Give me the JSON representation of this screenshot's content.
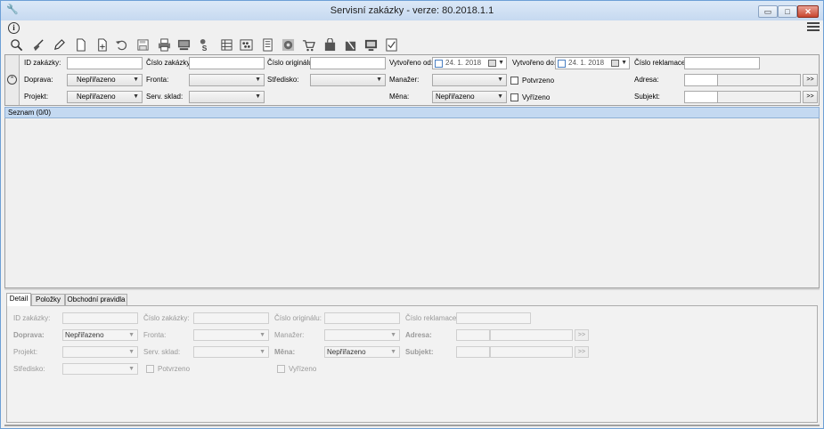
{
  "window": {
    "title": "Servisní zakázky - verze: 80.2018.1.1",
    "min_label": "▭",
    "max_label": "□",
    "close_label": "✕"
  },
  "info_label": "i",
  "toolbar": {
    "icons": [
      "search-icon",
      "broom-icon",
      "edit-icon",
      "new-document-icon",
      "add-document-icon",
      "undo-icon",
      "save-icon",
      "print-icon",
      "computer-icon",
      "service-icon",
      "archive-icon",
      "abacus-icon",
      "report-icon",
      "disc-icon",
      "cart-icon",
      "bag-icon",
      "delete-basket-icon",
      "screen-icon",
      "checklist-icon"
    ]
  },
  "filter": {
    "collapse_symbol": "⌃",
    "id_zakazky": {
      "label": "ID zakázky:",
      "value": ""
    },
    "cislo_zakazky": {
      "label": "Číslo zakázky:",
      "value": ""
    },
    "cislo_originalu": {
      "label": "Číslo originálu:",
      "value": ""
    },
    "vytvoreno_od": {
      "label": "Vytvořeno od:",
      "value": "24.   1. 2018"
    },
    "vytvoreno_do": {
      "label": "Vytvořeno do:",
      "value": "24.   1. 2018"
    },
    "cislo_reklamace": {
      "label": "Číslo reklamace:",
      "value": ""
    },
    "doprava": {
      "label": "Doprava:",
      "value": "Nepřiřazeno"
    },
    "fronta": {
      "label": "Fronta:",
      "value": ""
    },
    "stredisko": {
      "label": "Středisko:",
      "value": ""
    },
    "manazer": {
      "label": "Manažer:",
      "value": ""
    },
    "potvrzeno": {
      "label": "Potvrzeno"
    },
    "adresa": {
      "label": "Adresa:",
      "browse": ">>"
    },
    "projekt": {
      "label": "Projekt:",
      "value": "Nepřiřazeno"
    },
    "serv_sklad": {
      "label": "Serv. sklad:",
      "value": ""
    },
    "mena": {
      "label": "Měna:",
      "value": "Nepřiřazeno"
    },
    "vyrizeno": {
      "label": "Vyřízeno"
    },
    "subjekt": {
      "label": "Subjekt:",
      "browse": ">>"
    }
  },
  "list": {
    "header": "Seznam (0/0)"
  },
  "detail": {
    "tabs": [
      "Detail",
      "Položky",
      "Obchodní pravidla"
    ],
    "id_zakazky": "ID zakázky:",
    "cislo_zakazky": "Číslo zakázky:",
    "cislo_originalu": "Číslo originálu:",
    "cislo_reklamace": "Číslo reklamace:",
    "doprava": {
      "label": "Doprava:",
      "value": "Nepřiřazeno"
    },
    "fronta": "Fronta:",
    "manazer": "Manažer:",
    "adresa": "Adresa:",
    "projekt": "Projekt:",
    "serv_sklad": "Serv. sklad:",
    "mena": {
      "label": "Měna:",
      "value": "Nepřiřazeno"
    },
    "subjekt": "Subjekt:",
    "stredisko": "Středisko:",
    "potvrzeno": "Potvrzeno",
    "vyrizeno": "Vyřízeno",
    "browse": ">>"
  }
}
